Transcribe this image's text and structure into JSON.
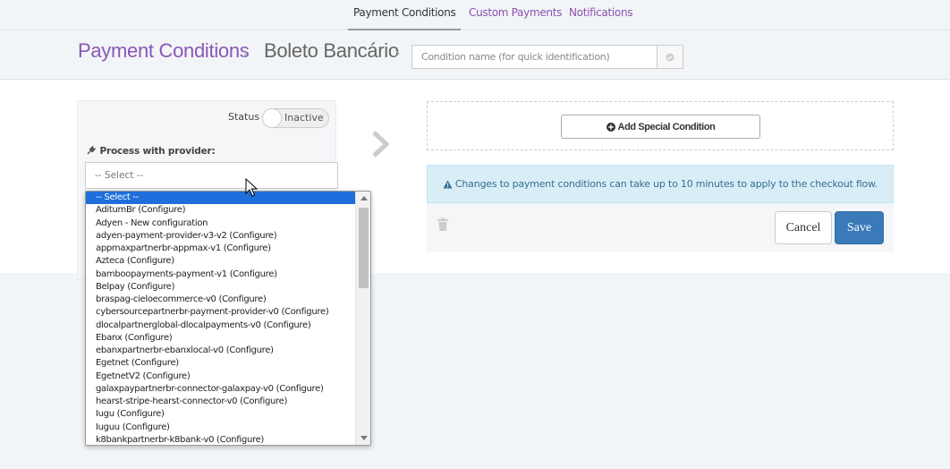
{
  "tabs": [
    {
      "label": "Payment Conditions",
      "active": true
    },
    {
      "label": "Custom Payments",
      "active": false
    },
    {
      "label": "Notifications",
      "active": false
    }
  ],
  "breadcrumb": {
    "section": "Payment Conditions",
    "method": "Boleto Bancário",
    "separator": "›"
  },
  "condition_name": {
    "placeholder": "Condition name (for quick identification)",
    "value": ""
  },
  "status": {
    "label": "Status",
    "toggle_text": "Inactive"
  },
  "provider": {
    "label": "Process with provider:",
    "selected": "-- Select --",
    "options": [
      "-- Select --",
      "AditumBr (Configure)",
      "Adyen - New configuration",
      "adyen-payment-provider-v3-v2 (Configure)",
      "appmaxpartnerbr-appmax-v1 (Configure)",
      "Azteca (Configure)",
      "bamboopayments-payment-v1 (Configure)",
      "Belpay (Configure)",
      "braspag-cieloecommerce-v0 (Configure)",
      "cybersourcepartnerbr-payment-provider-v0 (Configure)",
      "dlocalpartnerglobal-dlocalpayments-v0 (Configure)",
      "Ebanx (Configure)",
      "ebanxpartnerbr-ebanxlocal-v0 (Configure)",
      "Egetnet (Configure)",
      "EgetnetV2 (Configure)",
      "galaxpaypartnerbr-connector-galaxpay-v0 (Configure)",
      "hearst-stripe-hearst-connector-v0 (Configure)",
      "Iugu (Configure)",
      "Iuguu (Configure)",
      "k8bankpartnerbr-k8bank-v0 (Configure)"
    ]
  },
  "special_condition": {
    "add_label": "Add Special Condition"
  },
  "alert": {
    "text": "Changes to payment conditions can take up to 10 minutes to apply to the checkout flow."
  },
  "actions": {
    "cancel_label": "Cancel",
    "save_label": "Save"
  },
  "colors": {
    "brand_purple": "#8a56b8",
    "primary_blue": "#3a7ab8",
    "alert_bg": "#d9edf7",
    "alert_text": "#31708f",
    "option_selected": "#1e6fdc"
  }
}
